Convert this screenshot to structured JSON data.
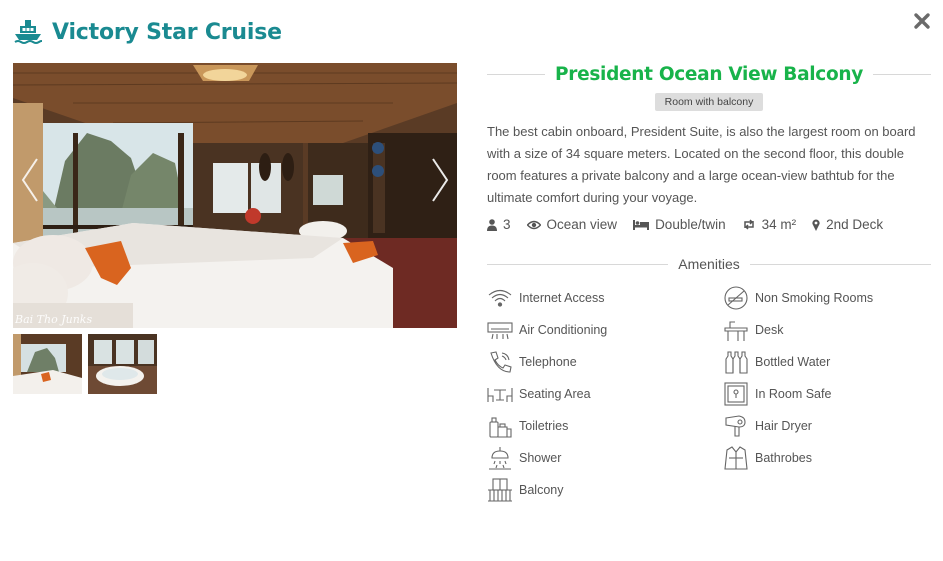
{
  "header": {
    "title": "Victory Star Cruise",
    "icon": "ship-icon",
    "brand_color": "#1a8a91"
  },
  "room": {
    "title": "President Ocean View Balcony",
    "title_color": "#18b34a",
    "badge": "Room with balcony",
    "description": "The best cabin onboard, President Suite, is also the largest room on board with a size of 34 square meters. Located on the second floor, this double room features a private balcony and a large ocean-view bathtub for the ultimate comfort during your voyage.",
    "specs": {
      "guests": "3",
      "view": "Ocean view",
      "bed": "Double/twin",
      "size": "34 m²",
      "deck": "2nd Deck"
    }
  },
  "gallery": {
    "watermark": "Bai Tho Junks"
  },
  "amenities": {
    "heading": "Amenities",
    "items": [
      {
        "label": "Internet Access",
        "icon": "wifi-icon"
      },
      {
        "label": "Non Smoking Rooms",
        "icon": "no-smoking-icon"
      },
      {
        "label": "Air Conditioning",
        "icon": "air-conditioner-icon"
      },
      {
        "label": "Desk",
        "icon": "desk-icon"
      },
      {
        "label": "Telephone",
        "icon": "telephone-icon"
      },
      {
        "label": "Bottled Water",
        "icon": "bottled-water-icon"
      },
      {
        "label": "Seating Area",
        "icon": "seating-area-icon"
      },
      {
        "label": "In Room Safe",
        "icon": "safe-icon"
      },
      {
        "label": "Toiletries",
        "icon": "toiletries-icon"
      },
      {
        "label": "Hair Dryer",
        "icon": "hair-dryer-icon"
      },
      {
        "label": "Shower",
        "icon": "shower-icon"
      },
      {
        "label": "Bathrobes",
        "icon": "bathrobe-icon"
      },
      {
        "label": "Balcony",
        "icon": "balcony-icon"
      }
    ]
  }
}
